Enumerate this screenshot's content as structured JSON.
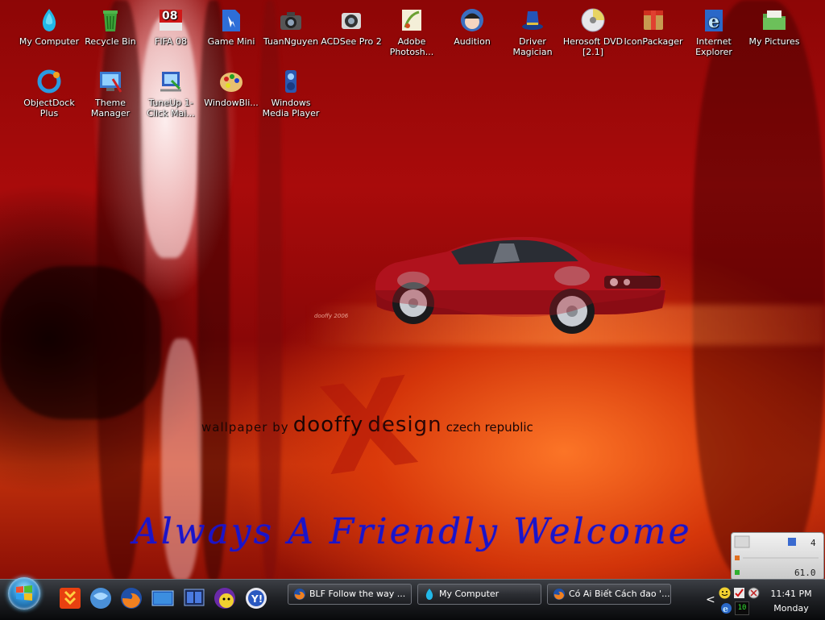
{
  "desktop": {
    "icons": [
      {
        "label": "My Computer",
        "icon": "my-computer-icon"
      },
      {
        "label": "Recycle Bin",
        "icon": "recycle-bin-icon"
      },
      {
        "label": "FIFA 08",
        "icon": "fifa-08-icon",
        "badge": "08"
      },
      {
        "label": "Game Mini",
        "icon": "game-mini-icon"
      },
      {
        "label": "TuanNguyen",
        "icon": "camera-icon"
      },
      {
        "label": "ACDSee Pro 2",
        "icon": "acdsee-icon"
      },
      {
        "label": "Adobe Photosh...",
        "icon": "photoshop-icon"
      },
      {
        "label": "Audition",
        "icon": "audition-icon"
      },
      {
        "label": "Driver Magician",
        "icon": "driver-magician-icon"
      },
      {
        "label": "Herosoft DVD [2.1]",
        "icon": "dvd-icon"
      },
      {
        "label": "IconPackager",
        "icon": "iconpackager-icon"
      },
      {
        "label": "Internet Explorer",
        "icon": "internet-explorer-icon"
      },
      {
        "label": "My Pictures",
        "icon": "folder-icon"
      },
      {
        "label": "ObjectDock Plus",
        "icon": "objectdock-icon"
      },
      {
        "label": "Theme Manager",
        "icon": "theme-manager-icon"
      },
      {
        "label": "TuneUp 1-Click Mai...",
        "icon": "tuneup-icon"
      },
      {
        "label": "WindowBli...",
        "icon": "windowblinds-icon"
      },
      {
        "label": "Windows Media Player",
        "icon": "media-player-icon"
      }
    ]
  },
  "wallpaper": {
    "credit_prefix": "wallpaper by",
    "credit_brand_1": "dooffy",
    "credit_brand_2": "design",
    "credit_suffix": "czech republic",
    "signature": "dooffy 2006",
    "x_mark": "X",
    "welcome": "Always A Friendly Welcome"
  },
  "gadget": {
    "count": "4",
    "value": "61.0"
  },
  "taskbar": {
    "quick_launch": [
      "flashget-icon",
      "windows-orb-icon",
      "firefox-icon",
      "show-desktop-icon",
      "switch-windows-icon",
      "yahoo-messenger-icon",
      "yahoo-icon"
    ],
    "tasks": [
      {
        "label": "BLF Follow the way ...",
        "icon": "firefox-icon"
      },
      {
        "label": "My Computer",
        "icon": "my-computer-icon"
      },
      {
        "label": "Có Ai Biết Cách đao '...",
        "icon": "firefox-icon"
      }
    ],
    "tray_chevron": "<",
    "tray_badge": "10",
    "clock_time": "11:41 PM",
    "clock_day": "Monday"
  },
  "colors": {
    "welcome_text": "#1a14c8",
    "taskbar": "#202226",
    "wallpaper_base": "#8d0606"
  }
}
